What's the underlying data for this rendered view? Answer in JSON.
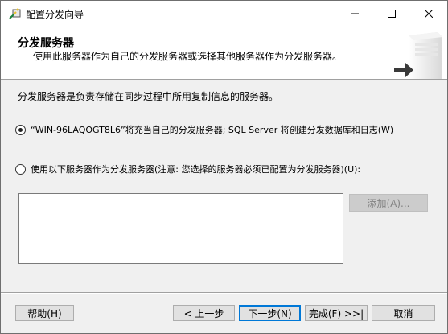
{
  "window": {
    "title": "配置分发向导",
    "icon": "wizard-icon"
  },
  "header": {
    "title": "分发服务器",
    "subtitle": "使用此服务器作为自己的分发服务器或选择其他服务器作为分发服务器。"
  },
  "body": {
    "intro": "分发服务器是负责存储在同步过程中所用复制信息的服务器。",
    "option_self": "“WIN-96LAQOGT8L6”将充当自己的分发服务器; SQL Server 将创建分发数据库和日志(W)",
    "option_other": "使用以下服务器作为分发服务器(注意: 您选择的服务器必须已配置为分发服务器)(U):",
    "selected_option": "option_self",
    "add_button": "添加(A)..."
  },
  "footer": {
    "help": "帮助(H)",
    "back": "< 上一步",
    "next": "下一步(N)",
    "finish": "完成(F) >>|",
    "cancel": "取消"
  }
}
